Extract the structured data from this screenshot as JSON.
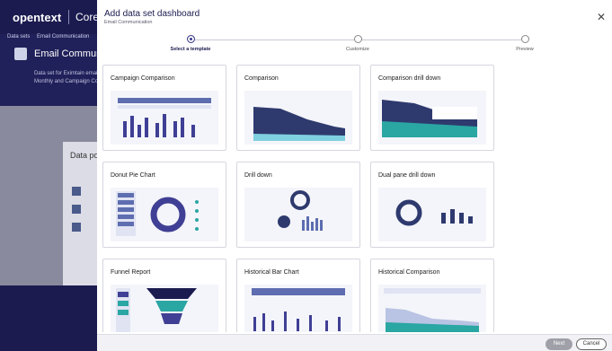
{
  "background": {
    "logo": "opentext",
    "product": "Core",
    "breadcrumb": [
      "Data sets",
      "Email Communication"
    ],
    "dataset_title": "Email Communica",
    "description": "Data set for Eximtain email Monthly and Campaign Co",
    "panel_title": "Data po"
  },
  "modal": {
    "title": "Add data set dashboard",
    "subtitle": "Email Communication",
    "close_icon": "close-icon"
  },
  "steps": [
    {
      "label": "Select a template",
      "state": "active"
    },
    {
      "label": "Customize",
      "state": "pending"
    },
    {
      "label": "Preview",
      "state": "pending"
    }
  ],
  "templates": [
    {
      "title": "Campaign Comparison",
      "thumb": "campaign"
    },
    {
      "title": "Comparison",
      "thumb": "area"
    },
    {
      "title": "Comparison drill down",
      "thumb": "drilldown-area"
    },
    {
      "title": "Donut Pie Chart",
      "thumb": "donut"
    },
    {
      "title": "Drill down",
      "thumb": "drill"
    },
    {
      "title": "Dual pane drill down",
      "thumb": "dual"
    },
    {
      "title": "Funnel Report",
      "thumb": "funnel"
    },
    {
      "title": "Historical Bar Chart",
      "thumb": "histbar"
    },
    {
      "title": "Historical Comparison",
      "thumb": "histarea"
    }
  ],
  "footer": {
    "next_label": "Next",
    "cancel_label": "Cancel"
  },
  "colors": {
    "brand_dark": "#1b1b50",
    "accent": "#3b3b8c",
    "bar": "#3f3f95",
    "area": "#2e3a6e",
    "teal": "#2aa6a3"
  }
}
